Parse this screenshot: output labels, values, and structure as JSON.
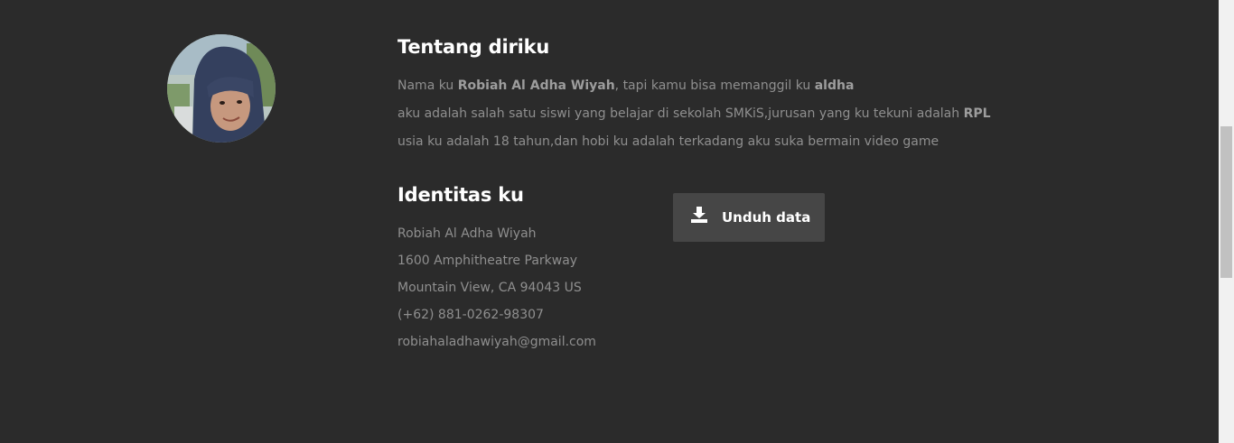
{
  "about": {
    "title": "Tentang diriku",
    "line1": {
      "prefix": "Nama ku ",
      "name": "Robiah Al Adha Wiyah",
      "middle": ", tapi kamu bisa memanggil ku ",
      "nickname": "aldha"
    },
    "line2": {
      "text": "aku adalah salah satu siswi yang belajar di sekolah SMKiS,jurusan yang ku tekuni adalah ",
      "major": "RPL"
    },
    "line3": "usia ku adalah 18 tahun,dan hobi ku adalah terkadang aku suka bermain video game"
  },
  "identity": {
    "title": "Identitas ku",
    "name": "Robiah Al Adha Wiyah",
    "street": "1600 Amphitheatre Parkway",
    "city": "Mountain View, CA 94043 US",
    "phone": "(+62) 881-0262-98307",
    "email": "robiahaladhawiyah@gmail.com"
  },
  "download_button": {
    "label": "Unduh data",
    "icon": "download-icon"
  },
  "avatar": {
    "icon": "profile-photo"
  }
}
